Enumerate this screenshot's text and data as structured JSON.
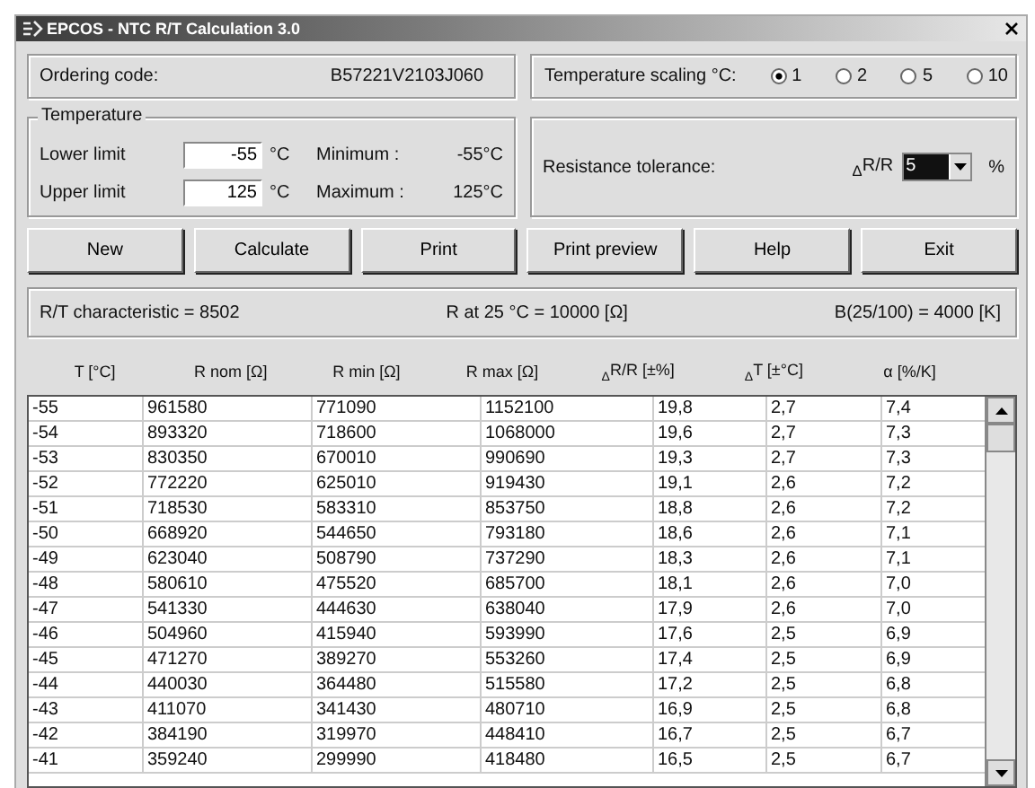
{
  "window": {
    "title": "EPCOS - NTC R/T Calculation 3.0"
  },
  "ordering": {
    "label": "Ordering code:",
    "value": "B57221V2103J060"
  },
  "scaling": {
    "label": "Temperature scaling °C:",
    "options": [
      {
        "label": "1",
        "selected": true
      },
      {
        "label": "2",
        "selected": false
      },
      {
        "label": "5",
        "selected": false
      },
      {
        "label": "10",
        "selected": false
      }
    ]
  },
  "temperature": {
    "title": "Temperature",
    "rows": [
      {
        "label": "Lower limit",
        "value": "-55",
        "unit": "°C",
        "info_label": "Minimum :",
        "info_value": "-55°C"
      },
      {
        "label": "Upper limit",
        "value": "125",
        "unit": "°C",
        "info_label": "Maximum :",
        "info_value": "125°C"
      }
    ]
  },
  "tolerance": {
    "label": "Resistance tolerance:",
    "symbol": "$_{Δ}$R/R",
    "value": "5",
    "unit": "%"
  },
  "buttons": [
    "New",
    "Calculate",
    "Print",
    "Print preview",
    "Help",
    "Exit"
  ],
  "info": [
    "R/T characteristic = 8502",
    "R at 25 °C = 10000 [Ω]",
    "B(25/100) = 4000 [K]"
  ],
  "table": {
    "columns": [
      "T [°C]",
      "R nom  [Ω]",
      "R min  [Ω]",
      "R max  [Ω]",
      "$_{Δ}$R/R [±%]",
      "$_{Δ}$T [±°C]",
      "α [%/K]"
    ],
    "rows": [
      [
        "-55",
        "961580",
        "771090",
        "1152100",
        "19,8",
        "2,7",
        "7,4"
      ],
      [
        "-54",
        "893320",
        "718600",
        "1068000",
        "19,6",
        "2,7",
        "7,3"
      ],
      [
        "-53",
        "830350",
        "670010",
        "990690",
        "19,3",
        "2,7",
        "7,3"
      ],
      [
        "-52",
        "772220",
        "625010",
        "919430",
        "19,1",
        "2,6",
        "7,2"
      ],
      [
        "-51",
        "718530",
        "583310",
        "853750",
        "18,8",
        "2,6",
        "7,2"
      ],
      [
        "-50",
        "668920",
        "544650",
        "793180",
        "18,6",
        "2,6",
        "7,1"
      ],
      [
        "-49",
        "623040",
        "508790",
        "737290",
        "18,3",
        "2,6",
        "7,1"
      ],
      [
        "-48",
        "580610",
        "475520",
        "685700",
        "18,1",
        "2,6",
        "7,0"
      ],
      [
        "-47",
        "541330",
        "444630",
        "638040",
        "17,9",
        "2,6",
        "7,0"
      ],
      [
        "-46",
        "504960",
        "415940",
        "593990",
        "17,6",
        "2,5",
        "6,9"
      ],
      [
        "-45",
        "471270",
        "389270",
        "553260",
        "17,4",
        "2,5",
        "6,9"
      ],
      [
        "-44",
        "440030",
        "364480",
        "515580",
        "17,2",
        "2,5",
        "6,8"
      ],
      [
        "-43",
        "411070",
        "341430",
        "480710",
        "16,9",
        "2,5",
        "6,8"
      ],
      [
        "-42",
        "384190",
        "319970",
        "448410",
        "16,7",
        "2,5",
        "6,7"
      ],
      [
        "-41",
        "359240",
        "299990",
        "418480",
        "16,5",
        "2,5",
        "6,7"
      ]
    ]
  }
}
